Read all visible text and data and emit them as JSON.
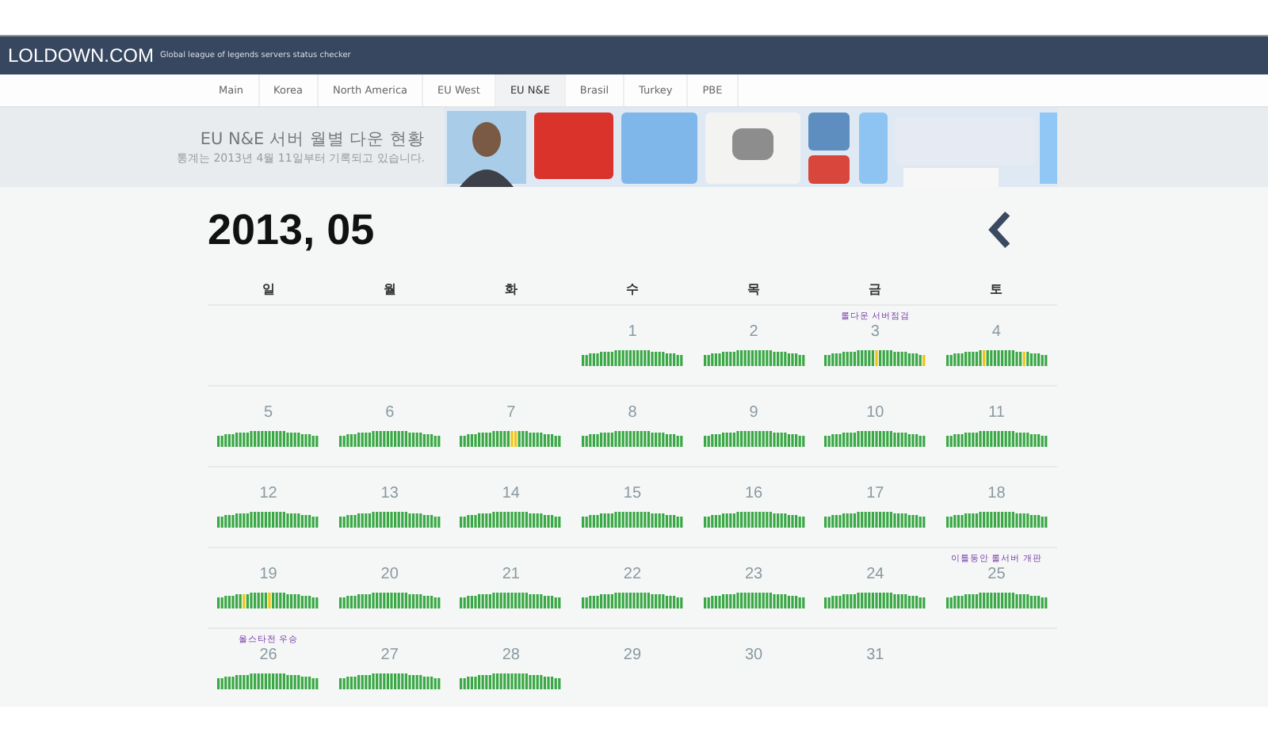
{
  "header": {
    "logo": "LOLDOWN.COM",
    "tagline": "Global league of legends servers status checker"
  },
  "nav": [
    {
      "label": "Main",
      "selected": false
    },
    {
      "label": "Korea",
      "selected": false
    },
    {
      "label": "North America",
      "selected": false
    },
    {
      "label": "EU West",
      "selected": false
    },
    {
      "label": "EU N&E",
      "selected": true
    },
    {
      "label": "Brasil",
      "selected": false
    },
    {
      "label": "Turkey",
      "selected": false
    },
    {
      "label": "PBE",
      "selected": false
    }
  ],
  "banner": {
    "title": "EU N&E 서버 월별 다운 현황",
    "subtitle": "통계는 2013년 4월 11일부터 기록되고 있습니다."
  },
  "calendar": {
    "title": "2013, 05",
    "weekdays": [
      "일",
      "월",
      "화",
      "수",
      "목",
      "금",
      "토"
    ],
    "days": [
      {
        "day": "1",
        "graph": true,
        "alerts": false
      },
      {
        "day": "2",
        "graph": true,
        "alerts": false
      },
      {
        "day": "3",
        "graph": true,
        "alerts": true,
        "note": "롤다운 서버점검"
      },
      {
        "day": "4",
        "graph": true,
        "alerts": true
      },
      {
        "day": "5",
        "graph": true,
        "alerts": false
      },
      {
        "day": "6",
        "graph": true,
        "alerts": false
      },
      {
        "day": "7",
        "graph": true,
        "alerts": true
      },
      {
        "day": "8",
        "graph": true,
        "alerts": false
      },
      {
        "day": "9",
        "graph": true,
        "alerts": false
      },
      {
        "day": "10",
        "graph": true,
        "alerts": false
      },
      {
        "day": "11",
        "graph": true,
        "alerts": false
      },
      {
        "day": "12",
        "graph": true,
        "alerts": false
      },
      {
        "day": "13",
        "graph": true,
        "alerts": false
      },
      {
        "day": "14",
        "graph": true,
        "alerts": false
      },
      {
        "day": "15",
        "graph": true,
        "alerts": false
      },
      {
        "day": "16",
        "graph": true,
        "alerts": false
      },
      {
        "day": "17",
        "graph": true,
        "alerts": false
      },
      {
        "day": "18",
        "graph": true,
        "alerts": false
      },
      {
        "day": "19",
        "graph": true,
        "alerts": true
      },
      {
        "day": "20",
        "graph": true,
        "alerts": false
      },
      {
        "day": "21",
        "graph": true,
        "alerts": false
      },
      {
        "day": "22",
        "graph": true,
        "alerts": false
      },
      {
        "day": "23",
        "graph": true,
        "alerts": false
      },
      {
        "day": "24",
        "graph": true,
        "alerts": false
      },
      {
        "day": "25",
        "graph": true,
        "alerts": false,
        "note": "이틀동안 롤서버 개판"
      },
      {
        "day": "26",
        "graph": true,
        "alerts": false,
        "note": "올스타전 우승"
      },
      {
        "day": "27",
        "graph": true,
        "alerts": false
      },
      {
        "day": "28",
        "graph": true,
        "alerts": false
      },
      {
        "day": "29",
        "graph": false
      },
      {
        "day": "30",
        "graph": false
      },
      {
        "day": "31",
        "graph": false
      }
    ]
  }
}
